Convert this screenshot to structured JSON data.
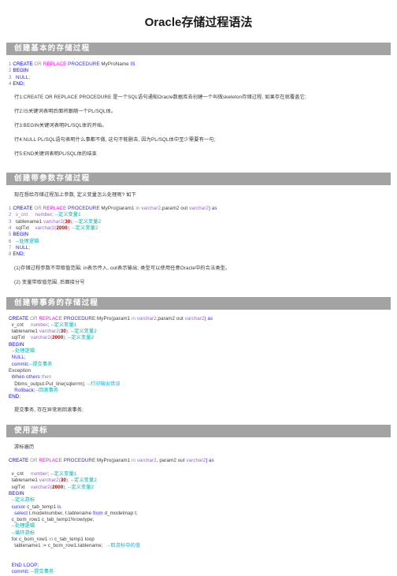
{
  "document": {
    "title": "Oracle存储过程语法",
    "theme": {
      "section_header_bg": "#a3a3a3",
      "section_header_text": "#ffffff",
      "keyword_blue": "#0000ff",
      "keyword_magenta": "#ff00ff",
      "comment_cyan": "#00b0b0",
      "number_red": "#c00000",
      "linenumber_violet": "#7b7bdd",
      "type_purple": "#9a5fd0",
      "body_text": "#333333",
      "page_bg": "#ffffff"
    }
  },
  "sections": [
    {
      "id": "basic",
      "header": "创建基本的存储过程",
      "code_lines": [
        [
          {
            "t": "1 ",
            "c": "ln"
          },
          {
            "t": "CREATE ",
            "c": "kw"
          },
          {
            "t": "OR ",
            "c": "gray"
          },
          {
            "t": "REPLACE ",
            "c": "mag"
          },
          {
            "t": "PROCEDURE ",
            "c": "kw2"
          },
          {
            "t": "MyProName ",
            "c": "id"
          },
          {
            "t": "IS",
            "c": "kw2"
          }
        ],
        [
          {
            "t": "2 ",
            "c": "ln"
          },
          {
            "t": "BEGIN",
            "c": "kw"
          }
        ],
        [
          {
            "t": "3   ",
            "c": "ln"
          },
          {
            "t": "NULL;",
            "c": "kw2"
          }
        ],
        [
          {
            "t": "4 ",
            "c": "ln"
          },
          {
            "t": "END;",
            "c": "kw"
          }
        ]
      ],
      "notes": [
        "行1:CREATE OR REPLACE PROCEDURE 是一个SQL语句通知Oracle数据库去创建一个叫做skeleton存储过程, 如果存在就覆盖它;",
        "行2:IS关键词表明后面将跟随一个PL/SQL体。",
        "行3:BEGIN关键词表明PL/SQL体的开始。",
        "行4:NULL PL/SQL语句表明什么事都不做, 这句不能删去, 因为PL/SQL体中至少需要有一句;",
        "行5:END关键词表明PL/SQL体的结束"
      ]
    },
    {
      "id": "params",
      "header": "创建带参数存储过程",
      "intro": "现在想给存储过程加上参数, 定义变量怎么处理呢? 如下",
      "code_lines": [
        [
          {
            "t": "1 ",
            "c": "ln"
          },
          {
            "t": "CREATE ",
            "c": "kw"
          },
          {
            "t": "OR ",
            "c": "gray"
          },
          {
            "t": "REPLACE ",
            "c": "mag"
          },
          {
            "t": "PROCEDURE ",
            "c": "kw2"
          },
          {
            "t": "MyPro(param1 ",
            "c": "id"
          },
          {
            "t": "in ",
            "c": "gray"
          },
          {
            "t": "varchar2",
            "c": "type"
          },
          {
            "t": ",param2 out ",
            "c": "id"
          },
          {
            "t": "varchar2",
            "c": "type"
          },
          {
            "t": ") as",
            "c": "kw2"
          }
        ],
        [
          {
            "t": "2   v_cnt     ",
            "c": "ln"
          },
          {
            "t": "number",
            "c": "type"
          },
          {
            "t": "; ",
            "c": "id"
          },
          {
            "t": "--定义变量1",
            "c": "cmt"
          }
        ],
        [
          {
            "t": "3   ",
            "c": "ln"
          },
          {
            "t": "tablename1 ",
            "c": "id"
          },
          {
            "t": "varchar2(",
            "c": "type"
          },
          {
            "t": "30",
            "c": "num"
          },
          {
            "t": "); ",
            "c": "type"
          },
          {
            "t": "--定义变量2",
            "c": "cmt"
          }
        ],
        [
          {
            "t": "4   ",
            "c": "ln"
          },
          {
            "t": "sqlTxt    ",
            "c": "id"
          },
          {
            "t": "varchar2(",
            "c": "type"
          },
          {
            "t": "2000",
            "c": "num"
          },
          {
            "t": "); ",
            "c": "type"
          },
          {
            "t": "--定义变量2",
            "c": "cmt"
          }
        ],
        [
          {
            "t": "5 ",
            "c": "ln"
          },
          {
            "t": "BEGIN",
            "c": "kw"
          }
        ],
        [
          {
            "t": "6   ",
            "c": "ln"
          },
          {
            "t": "--处理逻辑",
            "c": "cmt"
          }
        ],
        [
          {
            "t": "7   ",
            "c": "ln"
          },
          {
            "t": "NULL;",
            "c": "kw2"
          }
        ],
        [
          {
            "t": "8 ",
            "c": "ln"
          },
          {
            "t": "END;",
            "c": "kw"
          }
        ]
      ],
      "notes": [
        "(1)存储过程参数不带取值范围, in表示传入, out表示输出; 类型可以使用任意Oracle中的合法类型。",
        "(2) 变量带取值范围, 后面接分号"
      ]
    },
    {
      "id": "transaction",
      "header": "创建带事务的存储过程",
      "code_lines": [
        [
          {
            "t": "CREATE ",
            "c": "kw"
          },
          {
            "t": "OR ",
            "c": "gray"
          },
          {
            "t": "REPLACE ",
            "c": "mag"
          },
          {
            "t": "PROCEDURE ",
            "c": "kw2"
          },
          {
            "t": "MyPro(param1 ",
            "c": "id"
          },
          {
            "t": "in ",
            "c": "gray"
          },
          {
            "t": "varchar2",
            "c": "type"
          },
          {
            "t": ",param2 out ",
            "c": "id"
          },
          {
            "t": "varchar2",
            "c": "type"
          },
          {
            "t": ") as",
            "c": "kw2"
          }
        ],
        [
          {
            "t": "  v_cnt     ",
            "c": "id"
          },
          {
            "t": "number",
            "c": "type"
          },
          {
            "t": "; ",
            "c": "id"
          },
          {
            "t": "--定义变量1",
            "c": "cmt"
          }
        ],
        [
          {
            "t": "  tablename1 ",
            "c": "id"
          },
          {
            "t": "varchar2(",
            "c": "type"
          },
          {
            "t": "30",
            "c": "num"
          },
          {
            "t": "); ",
            "c": "type"
          },
          {
            "t": "--定义变量2",
            "c": "cmt"
          }
        ],
        [
          {
            "t": "  sqlTxt    ",
            "c": "id"
          },
          {
            "t": "varchar2(",
            "c": "type"
          },
          {
            "t": "2000",
            "c": "num"
          },
          {
            "t": "); ",
            "c": "type"
          },
          {
            "t": "--定义变量2",
            "c": "cmt"
          }
        ],
        [
          {
            "t": "BEGIN",
            "c": "kw"
          }
        ],
        [
          {
            "t": "  ",
            "c": "id"
          },
          {
            "t": "--处理逻辑",
            "c": "cmt"
          }
        ],
        [
          {
            "t": "  NULL;",
            "c": "kw2"
          }
        ],
        [
          {
            "t": "  commit;",
            "c": "kw2"
          },
          {
            "t": "--提交事务",
            "c": "cmt"
          }
        ],
        [
          {
            "t": "Exception",
            "c": "id"
          }
        ],
        [
          {
            "t": "  When others ",
            "c": "kw2"
          },
          {
            "t": "then",
            "c": "gray"
          }
        ],
        [
          {
            "t": "    Dbms_output.Put_line(sqlerrm); ",
            "c": "id"
          },
          {
            "t": "--打印输出错误",
            "c": "cmt2"
          }
        ],
        [
          {
            "t": "    Rollback;",
            "c": "kw2"
          },
          {
            "t": "--回滚事务",
            "c": "cmt"
          }
        ],
        [
          {
            "t": "END;",
            "c": "kw"
          }
        ]
      ],
      "notes": [
        "提交事务, 存在异常则回滚事务;"
      ]
    },
    {
      "id": "cursor",
      "header": "使用游标",
      "intro": "游标遍历",
      "code_lines": [
        [
          {
            "t": "CREATE ",
            "c": "kw"
          },
          {
            "t": "OR ",
            "c": "gray"
          },
          {
            "t": "REPLACE ",
            "c": "mag"
          },
          {
            "t": "PROCEDURE ",
            "c": "kw2"
          },
          {
            "t": "MyPro(param1 ",
            "c": "id"
          },
          {
            "t": "in ",
            "c": "gray"
          },
          {
            "t": "varchar2",
            "c": "type"
          },
          {
            "t": ", param2 out ",
            "c": "id"
          },
          {
            "t": "varchar2",
            "c": "type"
          },
          {
            "t": "] as",
            "c": "kw2"
          }
        ],
        [
          {
            "t": "",
            "c": "id"
          }
        ],
        [
          {
            "t": "  v_cnt     ",
            "c": "id"
          },
          {
            "t": "number",
            "c": "type"
          },
          {
            "t": "; ",
            "c": "id"
          },
          {
            "t": "--定义变量1",
            "c": "cmt"
          }
        ],
        [
          {
            "t": "  tablename1 ",
            "c": "id"
          },
          {
            "t": "varchar2(",
            "c": "type"
          },
          {
            "t": "30",
            "c": "num"
          },
          {
            "t": "); ",
            "c": "type"
          },
          {
            "t": "--定义变量2",
            "c": "cmt"
          }
        ],
        [
          {
            "t": "  sqlTxt    ",
            "c": "id"
          },
          {
            "t": "varchar2(",
            "c": "type"
          },
          {
            "t": "2000",
            "c": "num"
          },
          {
            "t": "); ",
            "c": "type"
          },
          {
            "t": "--定义变量2",
            "c": "cmt"
          }
        ],
        [
          {
            "t": "BEGIN",
            "c": "kw"
          }
        ],
        [
          {
            "t": "  ",
            "c": "id"
          },
          {
            "t": "--定义游标",
            "c": "cmt"
          }
        ],
        [
          {
            "t": "  cursor ",
            "c": "kw2"
          },
          {
            "t": "c_tab_temp1 ",
            "c": "id"
          },
          {
            "t": "is",
            "c": "kw2"
          }
        ],
        [
          {
            "t": "    select ",
            "c": "kw2"
          },
          {
            "t": "t.modelnumber, t.tablename ",
            "c": "id"
          },
          {
            "t": "from ",
            "c": "kw2"
          },
          {
            "t": "d_modelmap t;",
            "c": "id"
          }
        ],
        [
          {
            "t": "  c_bom_row1 c_tab_temp1%rowtype;",
            "c": "id"
          }
        ],
        [
          {
            "t": "  ",
            "c": "id"
          },
          {
            "t": "--处理逻辑",
            "c": "cmt"
          }
        ],
        [
          {
            "t": "  ",
            "c": "id"
          },
          {
            "t": "--循环游标",
            "c": "cmt"
          }
        ],
        [
          {
            "t": "  for ",
            "c": "kw2"
          },
          {
            "t": "c_bom_row1 ",
            "c": "id"
          },
          {
            "t": "in ",
            "c": "gray"
          },
          {
            "t": "c_tab_temp1 loop",
            "c": "id"
          }
        ],
        [
          {
            "t": "    tablename1 := c_bom_row1.tablename;   ",
            "c": "id"
          },
          {
            "t": "--取游标中的值",
            "c": "cmt2"
          }
        ],
        [
          {
            "t": "",
            "c": "id"
          }
        ],
        [
          {
            "t": "",
            "c": "id"
          }
        ],
        [
          {
            "t": "  END LOOP;",
            "c": "kw2"
          }
        ],
        [
          {
            "t": "  commit; ",
            "c": "kw2"
          },
          {
            "t": "--提交事务",
            "c": "cmt"
          }
        ]
      ],
      "notes": []
    }
  ]
}
